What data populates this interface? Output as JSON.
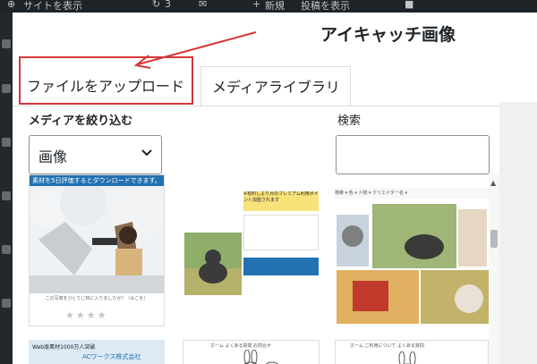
{
  "admin_bar": {
    "site_label": "サイトを表示",
    "updates_count": "3",
    "new_label": "新規",
    "view_post_label": "投稿を表示"
  },
  "modal": {
    "title": "アイキャッチ画像"
  },
  "tabs": [
    {
      "label": "ファイルをアップロード",
      "highlighted": true
    },
    {
      "label": "メディアライブラリ",
      "selected": true
    }
  ],
  "filter": {
    "label": "メディアを絞り込む",
    "selected_value": "画像"
  },
  "search": {
    "label": "検索",
    "value": ""
  },
  "media_items": [
    {
      "name": "thumbnail-1",
      "header_text": "素材を5日評価するとダウンロードできます。",
      "caption": "この写真をひとりじ知に入りましたか？（みこを）"
    },
    {
      "name": "thumbnail-2",
      "header_text": "※有料しより月のプレミアム利用ポイント加盟されます"
    },
    {
      "name": "thumbnail-3",
      "header_text": "検索 ▾ 色 ▾ 人物 ▾ クリエイター名 ▾"
    },
    {
      "name": "thumbnail-4",
      "header_text": "Web版素材1000万人突破",
      "sub_text": "ACワークス株式会社"
    },
    {
      "name": "thumbnail-5",
      "header_text": "ホーム よくある質問 お問合せ"
    },
    {
      "name": "thumbnail-6",
      "header_text": "ホーム ご利用について よくある質問"
    }
  ],
  "colors": {
    "highlight_red": "#d63638",
    "admin_bar_bg": "#1d2327",
    "border": "#dcdcde"
  }
}
